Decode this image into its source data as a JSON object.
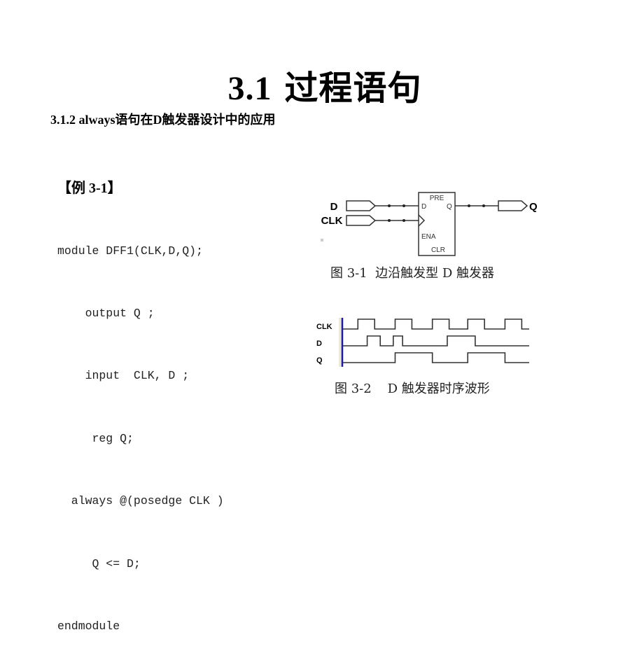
{
  "slide": {
    "title_number": "3.1",
    "title_text": "过程语句",
    "subtitle": "3.1.2  always语句在D触发器设计中的应用"
  },
  "example": {
    "label": "【例 3-1】",
    "code_lines": [
      "module DFF1(CLK,D,Q);",
      "    output Q ;",
      "    input  CLK, D ;",
      "     reg Q;",
      "  always @(posedge CLK )",
      "     Q <= D;",
      "endmodule"
    ]
  },
  "figure_3_1": {
    "caption": "图 3-1  边沿触发型 D 触发器",
    "inputs": [
      "D",
      "CLK"
    ],
    "output": "Q",
    "block_pins": {
      "top": "PRE",
      "d": "D",
      "q": "Q",
      "ena": "ENA",
      "bottom": "CLR"
    }
  },
  "figure_3_2": {
    "caption": "图 3-2    D 触发器时序波形",
    "signals": [
      {
        "name": "CLK",
        "transitions": [
          0,
          0.08,
          0.17,
          0.28,
          0.37,
          0.48,
          0.57,
          0.67,
          0.76,
          0.87,
          0.96,
          1.0
        ],
        "start": 0
      },
      {
        "name": "D",
        "transitions": [
          0,
          0.13,
          0.2,
          0.27,
          0.32,
          0.56,
          0.71,
          1.0
        ],
        "start": 0
      },
      {
        "name": "Q",
        "transitions": [
          0,
          0.28,
          0.48,
          0.67,
          0.87,
          1.0
        ],
        "start": 0
      }
    ]
  }
}
